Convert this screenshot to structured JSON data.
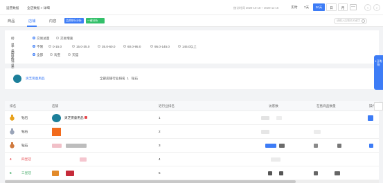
{
  "topbar": {
    "title": "运营数据",
    "breadcrumb": "全店数据 > 详细",
    "date_range": "统计时间 2020-10-18 ~ 2020-11-16",
    "buttons": {
      "realtime": "实时",
      "d7": "7天",
      "d30": "30天",
      "day": "日",
      "month": "月",
      "prev": "‹",
      "next": "›"
    }
  },
  "tabs": {
    "goods": "商品",
    "shop": "店铺",
    "content": "内容",
    "tag_rank": "品牌排行分析",
    "tag_analysis": "一键分析"
  },
  "search": {
    "placeholder": "请输入店铺名关键字"
  },
  "filters": {
    "rank_type": {
      "label": "榜单类型",
      "options": [
        "交易总量",
        "交易增速"
      ],
      "selected": 0
    },
    "price": {
      "label": "平均件单价",
      "options": [
        "不限",
        "0-15.0",
        "15.0-35.0",
        "35.0-60.0",
        "60.0-95.0",
        "95.0-145.0",
        "145.0以上"
      ],
      "selected": 0
    },
    "shop_type": {
      "label": "店铺类型",
      "options": [
        "全部",
        "淘宝",
        "天猫"
      ],
      "selected": 0
    }
  },
  "shopcard": {
    "name": "爽芝婴童用品",
    "rank_label": "全部店铺行业排名",
    "rank_value": "1",
    "level": "钻石"
  },
  "table": {
    "columns": [
      "排名",
      "店铺",
      "近行业排名",
      "访客数",
      "在售商品数量",
      "操作"
    ],
    "rows": [
      {
        "rank": "1",
        "level": "钻石",
        "name": "爽芝婴童用品",
        "industry_rank": "1"
      },
      {
        "rank": "2",
        "level": "钻石",
        "name": "",
        "industry_rank": "2"
      },
      {
        "rank": "3",
        "level": "钻石",
        "name": "",
        "industry_rank": "3"
      },
      {
        "rank": "4",
        "level": "四皇冠",
        "name": "",
        "industry_rank": "4"
      },
      {
        "rank": "5",
        "level": "三皇冠",
        "name": "",
        "industry_rank": "5"
      }
    ]
  },
  "float": {
    "label": "1日购物"
  },
  "colors": {
    "accent": "#3d7cf6",
    "green": "#33c06a",
    "gold": "#e8a21d",
    "silver": "#9aa4b8",
    "bronze": "#d07a3e",
    "red_rank": "#e5484d"
  }
}
